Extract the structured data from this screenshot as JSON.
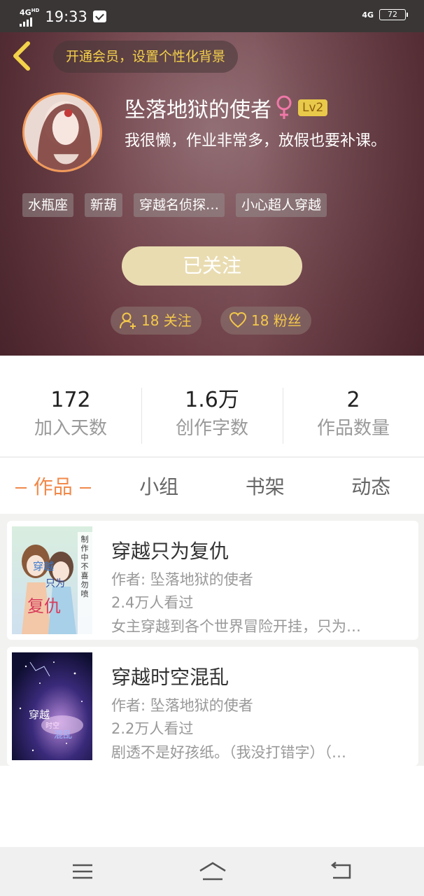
{
  "status_bar": {
    "network": "4G",
    "network_sup": "HD",
    "time": "19:33",
    "network_right": "4G",
    "battery": "72"
  },
  "header": {
    "vip_banner": "开通会员，设置个性化背景",
    "username": "坠落地狱的使者",
    "gender": "female",
    "level": "Lv2",
    "bio": "我很懒，作业非常多，放假也要补课。",
    "tags": [
      "水瓶座",
      "新葫",
      "穿越名侦探…",
      "小心超人穿越"
    ],
    "follow_button": "已关注",
    "following": "18 关注",
    "fans": "18 粉丝",
    "accent_color": "#f3c84a"
  },
  "stats": [
    {
      "value": "172",
      "label": "加入天数"
    },
    {
      "value": "1.6万",
      "label": "创作字数"
    },
    {
      "value": "2",
      "label": "作品数量"
    }
  ],
  "tabs": [
    {
      "label": "作品",
      "active": true
    },
    {
      "label": "小组",
      "active": false
    },
    {
      "label": "书架",
      "active": false
    },
    {
      "label": "动态",
      "active": false
    }
  ],
  "works": [
    {
      "title": "穿越只为复仇",
      "author": "作者: 坠落地狱的使者",
      "views": "2.4万人看过",
      "description": "女主穿越到各个世界冒险开挂，只为…",
      "cover_text": [
        "穿越",
        "只为",
        "复仇"
      ],
      "cover_side_text": "制作中不喜勿喷"
    },
    {
      "title": "穿越时空混乱",
      "author": "作者: 坠落地狱的使者",
      "views": "2.2万人看过",
      "description": "剧透不是好孩纸。（我没打错字）（…",
      "cover_text": [
        "穿越",
        "时空",
        "混乱"
      ]
    }
  ],
  "nav": {
    "menu_icon": "menu-icon",
    "home_icon": "home-icon",
    "back_icon": "back-icon"
  }
}
